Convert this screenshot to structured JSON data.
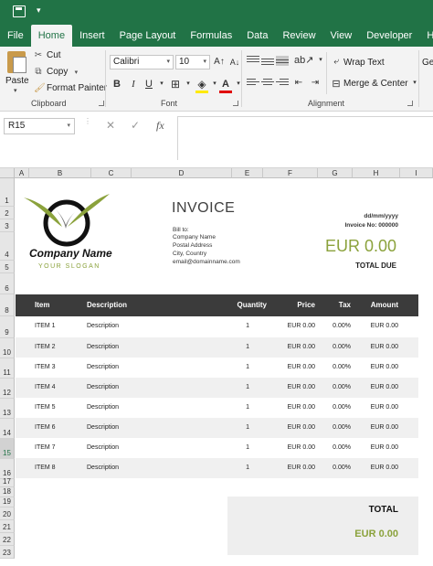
{
  "ribbon": {
    "tabs": [
      "File",
      "Home",
      "Insert",
      "Page Layout",
      "Formulas",
      "Data",
      "Review",
      "View",
      "Developer",
      "Help"
    ],
    "active_tab": "Home",
    "clipboard": {
      "paste": "Paste",
      "cut": "Cut",
      "copy": "Copy",
      "format_painter": "Format Painter",
      "group": "Clipboard"
    },
    "font": {
      "name": "Calibri",
      "size": "10",
      "group": "Font",
      "bold": "B",
      "italic": "I",
      "underline": "U",
      "font_color_glyph": "A"
    },
    "alignment": {
      "wrap_text": "Wrap Text",
      "merge_center": "Merge & Center",
      "group": "Alignment"
    },
    "number_format_partial": "Ge"
  },
  "formula_bar": {
    "name_box": "R15",
    "cancel": "✕",
    "enter": "✓",
    "fx": "fx",
    "content": ""
  },
  "columns": [
    "A",
    "B",
    "C",
    "D",
    "E",
    "F",
    "G",
    "H",
    "I"
  ],
  "rows": [
    "1",
    "2",
    "3",
    "4",
    "5",
    "6",
    "7",
    "8",
    "9",
    "10",
    "11",
    "12",
    "13",
    "14",
    "15",
    "16",
    "17",
    "18",
    "19",
    "20",
    "21",
    "22",
    "23"
  ],
  "selected_row": "15",
  "invoice": {
    "company_name": "Company Name",
    "slogan": "YOUR SLOGAN",
    "title": "INVOICE",
    "bill_to_label": "Bill to:",
    "bill_to": [
      "Company Name",
      "Postal Address",
      "City, Country",
      "email@domainname.com"
    ],
    "date": "dd/mm/yyyy",
    "invoice_no": "Invoice No: 000000",
    "total_amount": "EUR 0.00",
    "total_due_label": "TOTAL DUE",
    "headers": {
      "item": "Item",
      "description": "Description",
      "quantity": "Quantity",
      "price": "Price",
      "tax": "Tax",
      "amount": "Amount"
    },
    "items": [
      {
        "item": "ITEM 1",
        "description": "Description",
        "quantity": "1",
        "price": "EUR 0.00",
        "tax": "0.00%",
        "amount": "EUR 0.00"
      },
      {
        "item": "ITEM 2",
        "description": "Description",
        "quantity": "1",
        "price": "EUR 0.00",
        "tax": "0.00%",
        "amount": "EUR 0.00"
      },
      {
        "item": "ITEM 3",
        "description": "Description",
        "quantity": "1",
        "price": "EUR 0.00",
        "tax": "0.00%",
        "amount": "EUR 0.00"
      },
      {
        "item": "ITEM 4",
        "description": "Description",
        "quantity": "1",
        "price": "EUR 0.00",
        "tax": "0.00%",
        "amount": "EUR 0.00"
      },
      {
        "item": "ITEM 5",
        "description": "Description",
        "quantity": "1",
        "price": "EUR 0.00",
        "tax": "0.00%",
        "amount": "EUR 0.00"
      },
      {
        "item": "ITEM 6",
        "description": "Description",
        "quantity": "1",
        "price": "EUR 0.00",
        "tax": "0.00%",
        "amount": "EUR 0.00"
      },
      {
        "item": "ITEM 7",
        "description": "Description",
        "quantity": "1",
        "price": "EUR 0.00",
        "tax": "0.00%",
        "amount": "EUR 0.00"
      },
      {
        "item": "ITEM 8",
        "description": "Description",
        "quantity": "1",
        "price": "EUR 0.00",
        "tax": "0.00%",
        "amount": "EUR 0.00"
      }
    ],
    "summary_label": "TOTAL",
    "summary_value": "EUR 0.00"
  },
  "colors": {
    "excel_green": "#217346",
    "accent_olive": "#8ba23c",
    "header_dark": "#3b3b3b"
  }
}
